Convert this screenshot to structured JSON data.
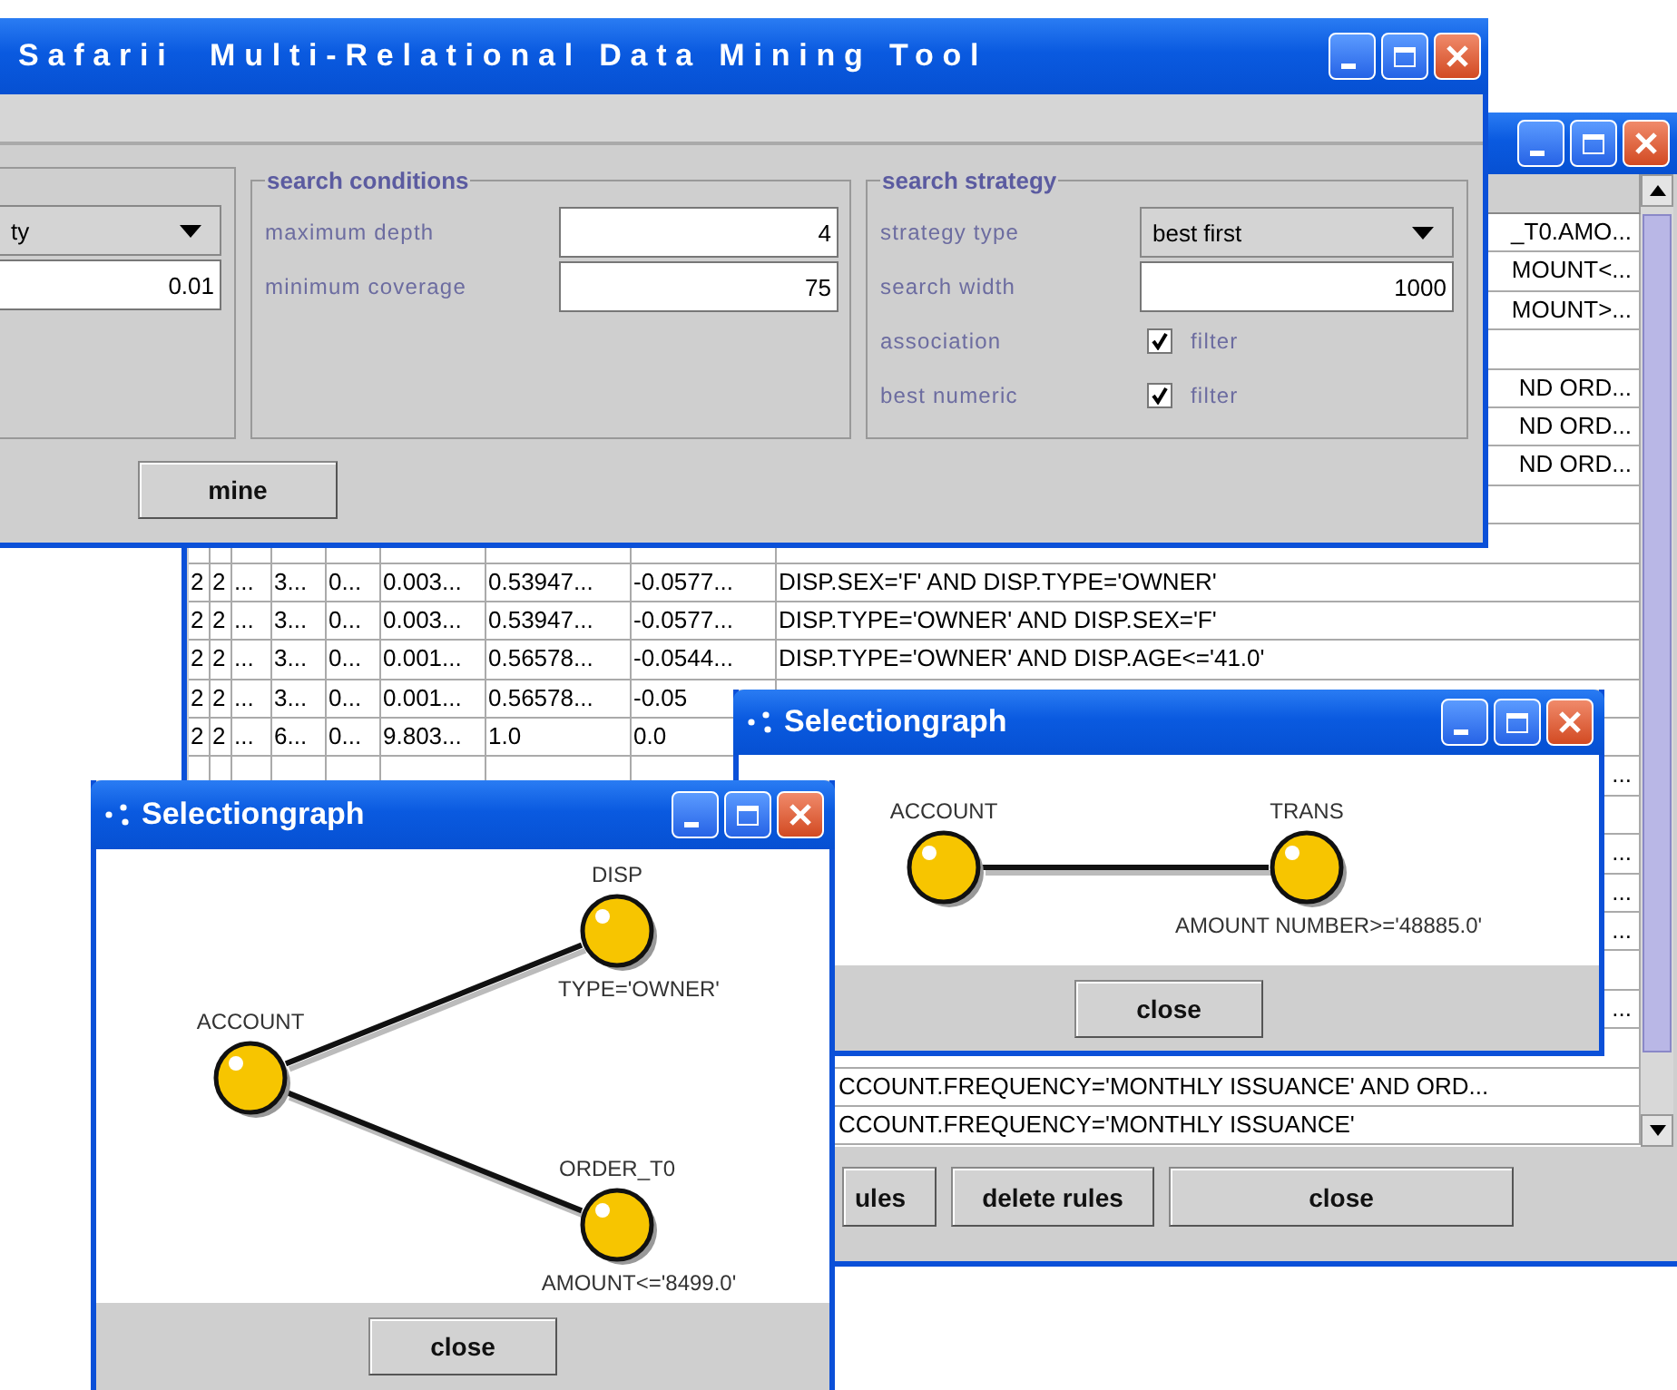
{
  "main_window": {
    "title": "Safarii  Multi-Relational Data Mining Tool",
    "left_panel": {
      "dropdown": "ty",
      "field": "0.01"
    },
    "search_conditions": {
      "title": "search conditions",
      "fields": [
        {
          "label": "maximum depth",
          "value": "4"
        },
        {
          "label": "minimum coverage",
          "value": "75"
        }
      ]
    },
    "search_strategy": {
      "title": "search strategy",
      "rows": [
        {
          "kind": "dropdown",
          "label": "strategy type",
          "value": "best first"
        },
        {
          "kind": "field",
          "label": "search width",
          "value": "1000"
        },
        {
          "kind": "checkbox",
          "label": "association",
          "checked": true,
          "text": "filter"
        },
        {
          "kind": "checkbox",
          "label": "best numeric",
          "checked": true,
          "text": "filter"
        }
      ]
    },
    "mine_button": "mine"
  },
  "rules_window": {
    "rows": [
      {
        "kind": "right",
        "text": "_T0.AMO..."
      },
      {
        "kind": "right",
        "text": "MOUNT<..."
      },
      {
        "kind": "right",
        "text": "MOUNT>..."
      },
      {
        "kind": "empty"
      },
      {
        "kind": "right",
        "text": "ND ORD..."
      },
      {
        "kind": "right",
        "text": "ND ORD..."
      },
      {
        "kind": "right",
        "text": "ND ORD..."
      },
      {
        "kind": "empty"
      },
      {
        "kind": "empty"
      },
      {
        "kind": "full",
        "cells": [
          "2",
          "2",
          "...",
          "3...",
          "0...",
          "0.003...",
          "0.53947...",
          "-0.0577...",
          "DISP.SEX='F' AND DISP.TYPE='OWNER'"
        ]
      },
      {
        "kind": "full",
        "cells": [
          "2",
          "2",
          "...",
          "3...",
          "0...",
          "0.003...",
          "0.53947...",
          "-0.0577...",
          "DISP.TYPE='OWNER' AND DISP.SEX='F'"
        ]
      },
      {
        "kind": "full",
        "cells": [
          "2",
          "2",
          "...",
          "3...",
          "0...",
          "0.001...",
          "0.56578...",
          "-0.0544...",
          "DISP.TYPE='OWNER' AND DISP.AGE<='41.0'"
        ]
      },
      {
        "kind": "full",
        "cells": [
          "2",
          "2",
          "...",
          "3...",
          "0...",
          "0.001...",
          "0.56578...",
          "-0.05"
        ]
      },
      {
        "kind": "full",
        "cells": [
          "2",
          "2",
          "...",
          "6...",
          "0...",
          "9.803...",
          "1.0",
          "0.0"
        ]
      },
      {
        "kind": "right",
        "text": "..."
      },
      {
        "kind": "empty"
      },
      {
        "kind": "right",
        "text": "..."
      },
      {
        "kind": "right",
        "text": "..."
      },
      {
        "kind": "right",
        "text": "..."
      },
      {
        "kind": "empty"
      },
      {
        "kind": "right",
        "text": "..."
      },
      {
        "kind": "empty"
      },
      {
        "kind": "clear",
        "text": "CCOUNT.FREQUENCY='MONTHLY ISSUANCE' AND ORD..."
      },
      {
        "kind": "clear",
        "text": "CCOUNT.FREQUENCY='MONTHLY ISSUANCE'"
      }
    ],
    "buttons": [
      "ules",
      "delete rules",
      "close"
    ]
  },
  "graph_windows": [
    {
      "title": "Selectiongraph",
      "nodes": [
        {
          "label": "ACCOUNT"
        },
        {
          "label": "TRANS",
          "condition": "AMOUNT NUMBER>='48885.0'"
        }
      ],
      "button": "close"
    },
    {
      "title": "Selectiongraph",
      "nodes": [
        {
          "label": "ACCOUNT"
        },
        {
          "label": "DISP",
          "condition": "TYPE='OWNER'"
        },
        {
          "label": "ORDER_T0",
          "condition": "AMOUNT<='8499.0'"
        }
      ],
      "button": "close"
    }
  ]
}
